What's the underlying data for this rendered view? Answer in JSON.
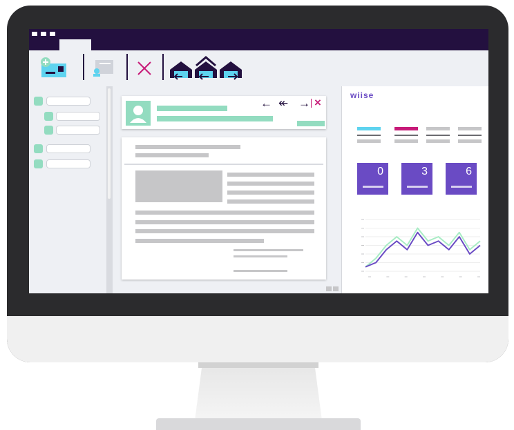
{
  "app": {
    "logo_text": "wiise"
  },
  "toolbar": {
    "icons": [
      "new-message-icon",
      "contact-card-icon",
      "delete-icon",
      "reply-icon",
      "reply-all-icon",
      "forward-icon"
    ]
  },
  "message": {
    "nav_icons": {
      "back": "←",
      "back_all": "↞",
      "forward": "→",
      "close": "×"
    }
  },
  "dashboard": {
    "tab_colors": [
      "#5ed3ef",
      "#c71a78",
      "#c6c6c8",
      "#c6c6c8"
    ],
    "metrics": [
      {
        "value": "0"
      },
      {
        "value": "3"
      },
      {
        "value": "6"
      }
    ]
  },
  "colors": {
    "dark_purple": "#23103f",
    "accent_purple": "#6a4bc4",
    "green": "#93dcc0",
    "magenta": "#c71a78",
    "cyan": "#5ed3ef"
  },
  "chart_data": {
    "type": "line",
    "x": [
      1,
      2,
      3,
      4,
      5,
      6,
      7,
      8,
      9,
      10,
      11,
      12
    ],
    "series": [
      {
        "values": [
          1,
          3,
          6,
          8,
          6,
          10,
          7,
          8,
          6,
          9,
          5,
          7
        ]
      },
      {
        "values": [
          1,
          2,
          5,
          7,
          5,
          9,
          6,
          7,
          5,
          8,
          4,
          6
        ]
      }
    ],
    "colors": [
      "#a7ecc4",
      "#6a4bc4"
    ],
    "ylim": [
      0,
      12
    ],
    "grid": true
  }
}
